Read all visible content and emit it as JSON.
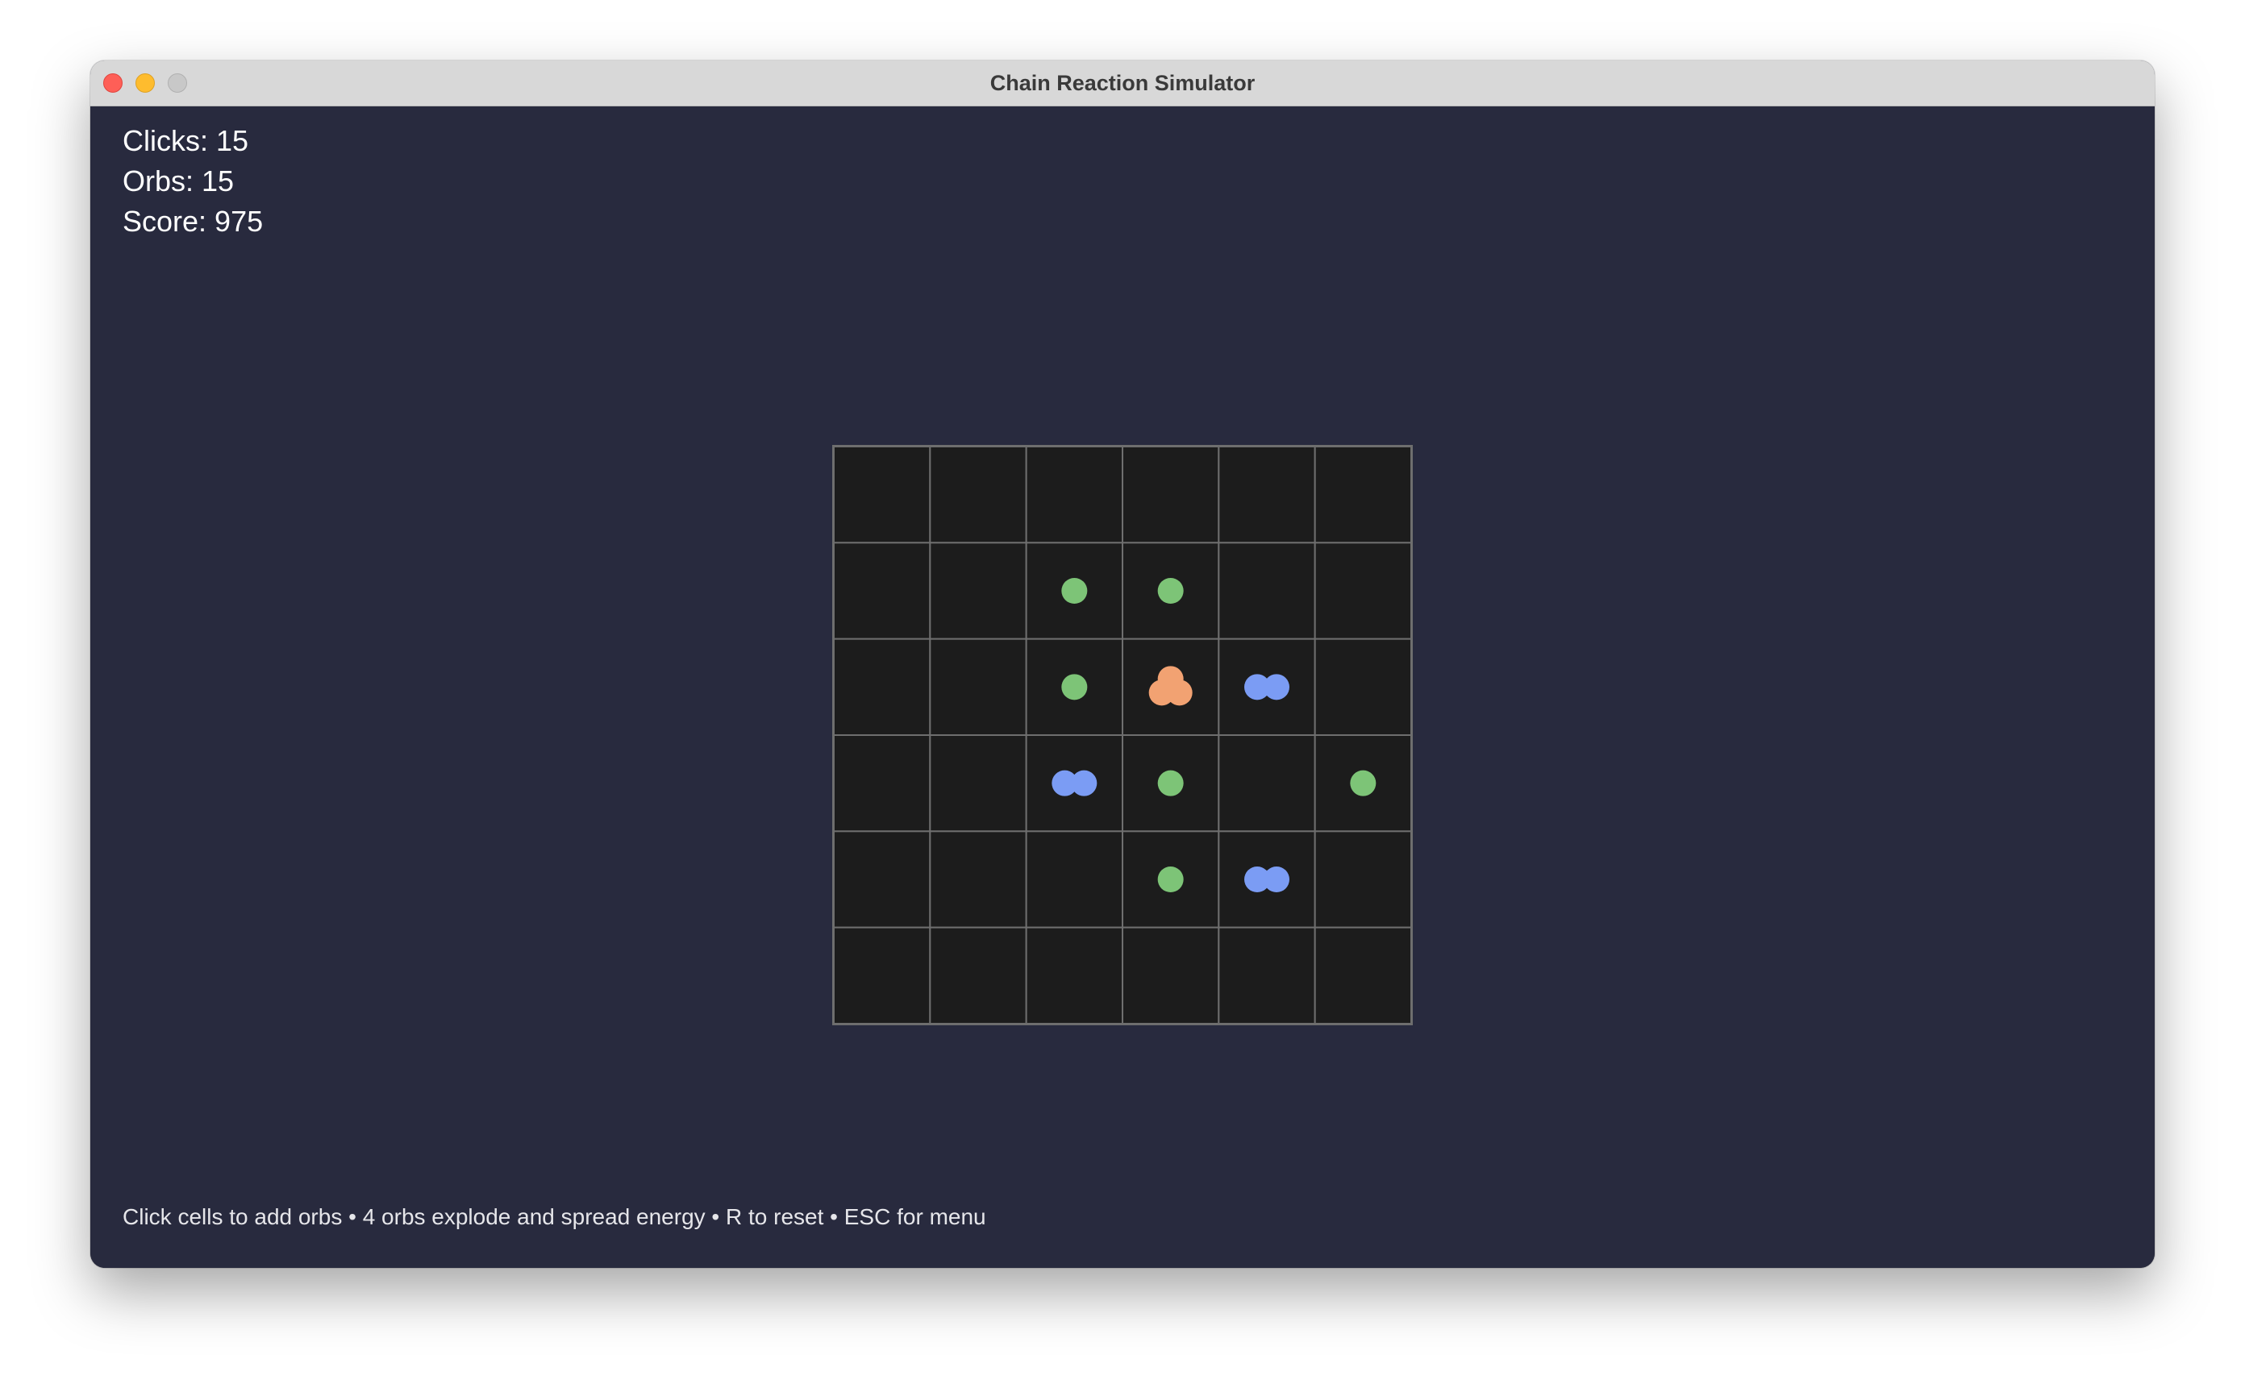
{
  "window": {
    "title": "Chain Reaction Simulator"
  },
  "stats": {
    "clicks": "Clicks: 15",
    "orbs": "Orbs: 15",
    "score": "Score: 975"
  },
  "help_text": "Click cells to add orbs • 4 orbs explode and spread energy • R to reset • ESC for menu",
  "colors": {
    "background": "#282a3e",
    "cell": "#1c1c1c",
    "grid_line": "#6e6e6e",
    "orb_1": "#7dc477",
    "orb_2": "#7b9cf4",
    "orb_3": "#f2a272"
  },
  "grid": {
    "rows": 6,
    "cols": 6,
    "orbs": [
      [
        0,
        0,
        0,
        0,
        0,
        0
      ],
      [
        0,
        0,
        1,
        1,
        0,
        0
      ],
      [
        0,
        0,
        1,
        3,
        2,
        0
      ],
      [
        0,
        0,
        2,
        1,
        0,
        1
      ],
      [
        0,
        0,
        0,
        1,
        2,
        0
      ],
      [
        0,
        0,
        0,
        0,
        0,
        0
      ]
    ]
  }
}
